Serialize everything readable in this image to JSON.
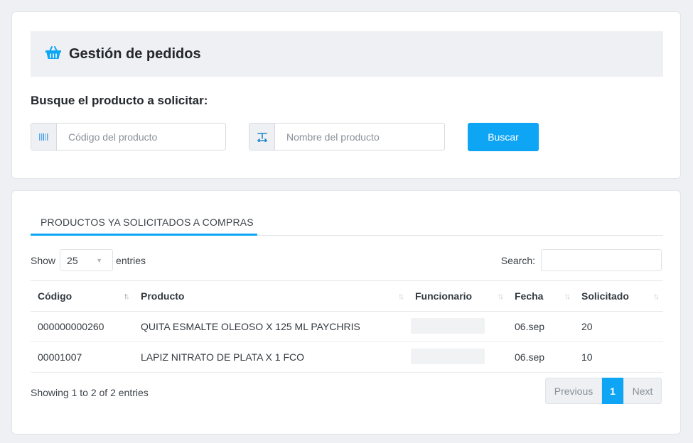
{
  "header": {
    "title": "Gestión de pedidos",
    "icon": "basket-icon"
  },
  "search_form": {
    "label": "Busque el producto a solicitar:",
    "code_placeholder": "Código del producto",
    "code_value": "",
    "name_placeholder": "Nombre del producto",
    "name_value": "",
    "submit_label": "Buscar"
  },
  "tabs": [
    {
      "label": "PRODUCTOS YA SOLICITADOS A COMPRAS",
      "active": true
    }
  ],
  "table_controls": {
    "show_label": "Show",
    "page_length": "25",
    "entries_label": "entries",
    "search_label": "Search:",
    "search_value": ""
  },
  "table": {
    "columns": [
      "Código",
      "Producto",
      "Funcionario",
      "Fecha",
      "Solicitado"
    ],
    "rows": [
      [
        "000000000260",
        "QUITA ESMALTE OLEOSO X 125 ML PAYCHRIS",
        "",
        "06.sep",
        "20"
      ],
      [
        "00001007",
        "LAPIZ NITRATO DE PLATA X 1 FCO",
        "",
        "06.sep",
        "10"
      ]
    ]
  },
  "pagination": {
    "info": "Showing 1 to 2 of 2 entries",
    "previous": "Previous",
    "current": "1",
    "next": "Next"
  },
  "colors": {
    "accent": "#0ea5f5",
    "background": "#eef0f3",
    "header_bar": "#eef0f4"
  }
}
